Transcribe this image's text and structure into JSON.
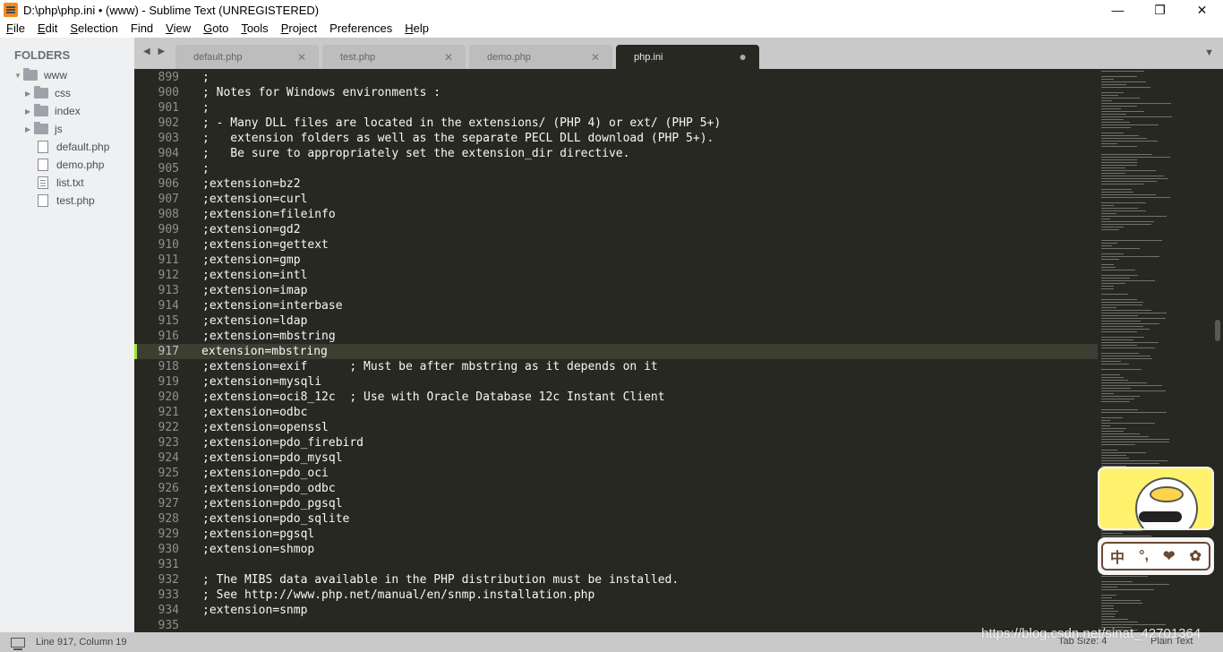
{
  "window": {
    "title": "D:\\php\\php.ini • (www) - Sublime Text (UNREGISTERED)",
    "controls": {
      "minimize": "—",
      "maximize": "❐",
      "close": "✕"
    }
  },
  "menu": [
    {
      "label": "File",
      "key": "F",
      "rest": "ile"
    },
    {
      "label": "Edit",
      "key": "E",
      "rest": "dit"
    },
    {
      "label": "Selection",
      "key": "S",
      "rest": "election"
    },
    {
      "label": "Find",
      "key": "F",
      "rest": "ind",
      "prefix": "",
      "underline_index": 1
    },
    {
      "label": "View",
      "key": "V",
      "rest": "iew"
    },
    {
      "label": "Goto",
      "key": "G",
      "rest": "oto"
    },
    {
      "label": "Tools",
      "key": "T",
      "rest": "ools"
    },
    {
      "label": "Project",
      "key": "P",
      "rest": "roject"
    },
    {
      "label": "Preferences",
      "key": "",
      "rest": "Preferences"
    },
    {
      "label": "Help",
      "key": "H",
      "rest": "elp"
    }
  ],
  "sidebar": {
    "header": "FOLDERS",
    "root": "www",
    "folders": [
      "css",
      "index",
      "js"
    ],
    "files": [
      "default.php",
      "demo.php",
      "list.txt",
      "test.php"
    ]
  },
  "tabs": [
    {
      "label": "default.php",
      "close": "✕",
      "active": false
    },
    {
      "label": "test.php",
      "close": "✕",
      "active": false
    },
    {
      "label": "demo.php",
      "close": "✕",
      "active": false
    },
    {
      "label": "php.ini",
      "close": "●",
      "active": true
    }
  ],
  "tab_nav": "◀ ▶",
  "tab_menu_arrow": "▼",
  "editor": {
    "current_line": 917,
    "lines": [
      {
        "n": "899",
        "t": ";"
      },
      {
        "n": "900",
        "t": "; Notes for Windows environments :"
      },
      {
        "n": "901",
        "t": ";"
      },
      {
        "n": "902",
        "t": "; - Many DLL files are located in the extensions/ (PHP 4) or ext/ (PHP 5+)"
      },
      {
        "n": "903",
        "t": ";   extension folders as well as the separate PECL DLL download (PHP 5+)."
      },
      {
        "n": "904",
        "t": ";   Be sure to appropriately set the extension_dir directive."
      },
      {
        "n": "905",
        "t": ";"
      },
      {
        "n": "906",
        "t": ";extension=bz2"
      },
      {
        "n": "907",
        "t": ";extension=curl"
      },
      {
        "n": "908",
        "t": ";extension=fileinfo"
      },
      {
        "n": "909",
        "t": ";extension=gd2"
      },
      {
        "n": "910",
        "t": ";extension=gettext"
      },
      {
        "n": "911",
        "t": ";extension=gmp"
      },
      {
        "n": "912",
        "t": ";extension=intl"
      },
      {
        "n": "913",
        "t": ";extension=imap"
      },
      {
        "n": "914",
        "t": ";extension=interbase"
      },
      {
        "n": "915",
        "t": ";extension=ldap"
      },
      {
        "n": "916",
        "t": ";extension=mbstring"
      },
      {
        "n": "917",
        "t": "extension=mbstring"
      },
      {
        "n": "918",
        "t": ";extension=exif      ; Must be after mbstring as it depends on it"
      },
      {
        "n": "919",
        "t": ";extension=mysqli"
      },
      {
        "n": "920",
        "t": ";extension=oci8_12c  ; Use with Oracle Database 12c Instant Client"
      },
      {
        "n": "921",
        "t": ";extension=odbc"
      },
      {
        "n": "922",
        "t": ";extension=openssl"
      },
      {
        "n": "923",
        "t": ";extension=pdo_firebird"
      },
      {
        "n": "924",
        "t": ";extension=pdo_mysql"
      },
      {
        "n": "925",
        "t": ";extension=pdo_oci"
      },
      {
        "n": "926",
        "t": ";extension=pdo_odbc"
      },
      {
        "n": "927",
        "t": ";extension=pdo_pgsql"
      },
      {
        "n": "928",
        "t": ";extension=pdo_sqlite"
      },
      {
        "n": "929",
        "t": ";extension=pgsql"
      },
      {
        "n": "930",
        "t": ";extension=shmop"
      },
      {
        "n": "931",
        "t": ""
      },
      {
        "n": "932",
        "t": "; The MIBS data available in the PHP distribution must be installed."
      },
      {
        "n": "933",
        "t": "; See http://www.php.net/manual/en/snmp.installation.php"
      },
      {
        "n": "934",
        "t": ";extension=snmp"
      },
      {
        "n": "935",
        "t": ""
      }
    ]
  },
  "ime": {
    "mode": "中",
    "punct": "°,",
    "heart": "❤",
    "gear": "✿"
  },
  "status": {
    "position": "Line 917, Column 19",
    "tab_size": "Tab Size: 4",
    "syntax": "Plain Text"
  },
  "watermark": "https://blog.csdn.net/sinat_42701364",
  "colors": {
    "editor_bg": "#272822",
    "current_line_bg": "#3e3d32",
    "modified_marker": "#a6e22e",
    "sidebar_bg": "#eff0f2",
    "tabbar_bg": "#c9c9c9"
  }
}
